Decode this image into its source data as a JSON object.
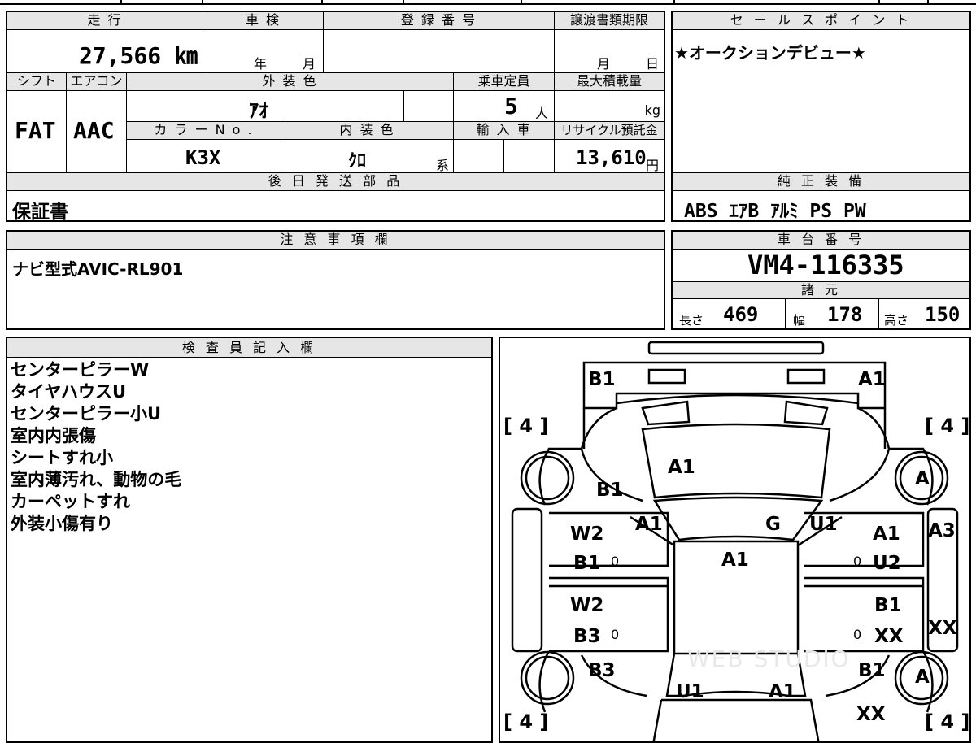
{
  "headers": {
    "mileage": "走 行",
    "shaken": "車 検",
    "registration": "登 録 番 号",
    "transfer_deadline": "譲渡書類期限",
    "sales_point": "セ ー ル ス ポ イ ン ト",
    "shift": "シフト",
    "aircon": "エアコン",
    "exterior_color": "外 装 色",
    "capacity": "乗車定員",
    "max_load": "最大積載量",
    "color_no": "カ ラ ー N o .",
    "interior_color": "内 装 色",
    "import": "輸 入 車",
    "recycle": "リサイクル預託金",
    "later_parts": "後 日 発 送 部 品",
    "genuine_equipment": "純 正 装 備",
    "notes": "注 意 事 項 欄",
    "chassis_no": "車 台 番 号",
    "specs": "諸 元",
    "inspector": "検 査 員 記 入 欄"
  },
  "values": {
    "mileage": "27,566 ㎞",
    "shaken_year_unit": "年",
    "shaken_month_unit": "月",
    "deadline_month_unit": "月",
    "deadline_day_unit": "日",
    "sales_point": "★オークションデビュー★",
    "shift": "FAT",
    "aircon": "AAC",
    "exterior_color": "ｱｵ",
    "capacity": "5",
    "capacity_unit": "人",
    "max_load_unit": "kg",
    "color_no": "K3X",
    "interior_color": "ｸﾛ",
    "interior_suffix": "系",
    "recycle": "13,610",
    "recycle_unit": "円",
    "later_parts": "保証書",
    "genuine_equipment": "ABS ｴｱB ｱﾙﾐ PS PW",
    "notes": "ナビ型式AVIC-RL901",
    "chassis_no": "VM4-116335",
    "length_label": "長さ",
    "length": "469",
    "width_label": "幅",
    "width": "178",
    "height_label": "高さ",
    "height": "150"
  },
  "inspector_remarks": [
    "センターピラーW",
    "タイヤハウスU",
    "センターピラー小U",
    "室内内張傷",
    "シートすれ小",
    "室内薄汚れ、動物の毛",
    "カーペットすれ",
    "外装小傷有り"
  ],
  "diagram": {
    "watermark": "WEB STUDIO",
    "brackets": [
      "[ 4 ]",
      "[ 4 ]",
      "[ 4 ]",
      "[ 4 ]"
    ],
    "marks": {
      "front_left": "B1",
      "front_right": "A1",
      "hood": "A1",
      "left_fender": "B1",
      "left_pillar": "A1",
      "glass": "G",
      "right_pillar": "U1",
      "roof": "A1",
      "left_front_door_1": "W2",
      "left_front_door_2": "B1",
      "left_rear_door_1": "W2",
      "left_rear_door_2": "B3",
      "right_front_door_1": "A1",
      "right_front_door_2": "U2",
      "right_rear_door_1": "B1",
      "right_rear_door_2": "XX",
      "right_side_front": "A3",
      "right_side_rear": "XX",
      "left_quarter": "B3",
      "right_quarter": "B1",
      "rear_left": "U1",
      "rear_right": "A1",
      "rear_bottom": "XX",
      "wheel_front_right": "A",
      "wheel_rear_right": "A",
      "zero_1": "0",
      "zero_2": "0",
      "zero_3": "0",
      "zero_4": "0"
    }
  }
}
